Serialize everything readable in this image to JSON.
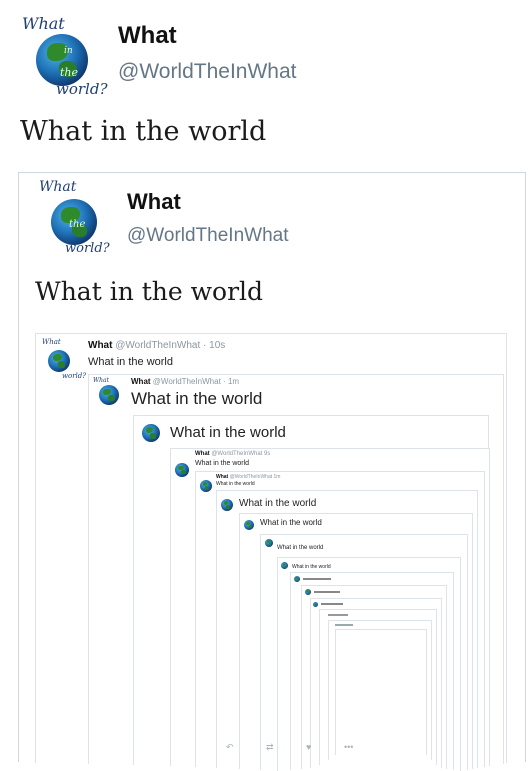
{
  "profile": {
    "name": "What",
    "handle": "@WorldTheInWhat",
    "logo": {
      "top": "What",
      "middle1": "in",
      "middle2": "the",
      "bottom": "world?"
    }
  },
  "tweet": {
    "text": "What in the world"
  },
  "quoted": {
    "name": "What",
    "handle": "@WorldTheInWhat",
    "text": "What in the world"
  },
  "nested": {
    "level1": {
      "name": "What",
      "handle": "@WorldTheInWhat",
      "time": "10s",
      "text": "What in the world"
    },
    "level2": {
      "name": "What",
      "handle": "@WorldTheInWhat",
      "time": "1m",
      "text": "What in the world"
    },
    "level3": {
      "text": "What in the world"
    },
    "level4": {
      "name": "What",
      "handle": "@WorldTheInWhat",
      "time": "9s",
      "text": "What in the world"
    },
    "level5": {
      "name": "What",
      "handle": "@WorldTheInWhat",
      "time": "1m",
      "text": "What in the world"
    },
    "level6": {
      "text": "What in the world"
    },
    "level7": {
      "text": "What in the world"
    },
    "level8": {
      "text": "What in the world"
    },
    "level9": {
      "text": "What in the world"
    }
  },
  "icons": [
    "reply-icon",
    "retweet-icon",
    "like-icon",
    "more-icon"
  ]
}
